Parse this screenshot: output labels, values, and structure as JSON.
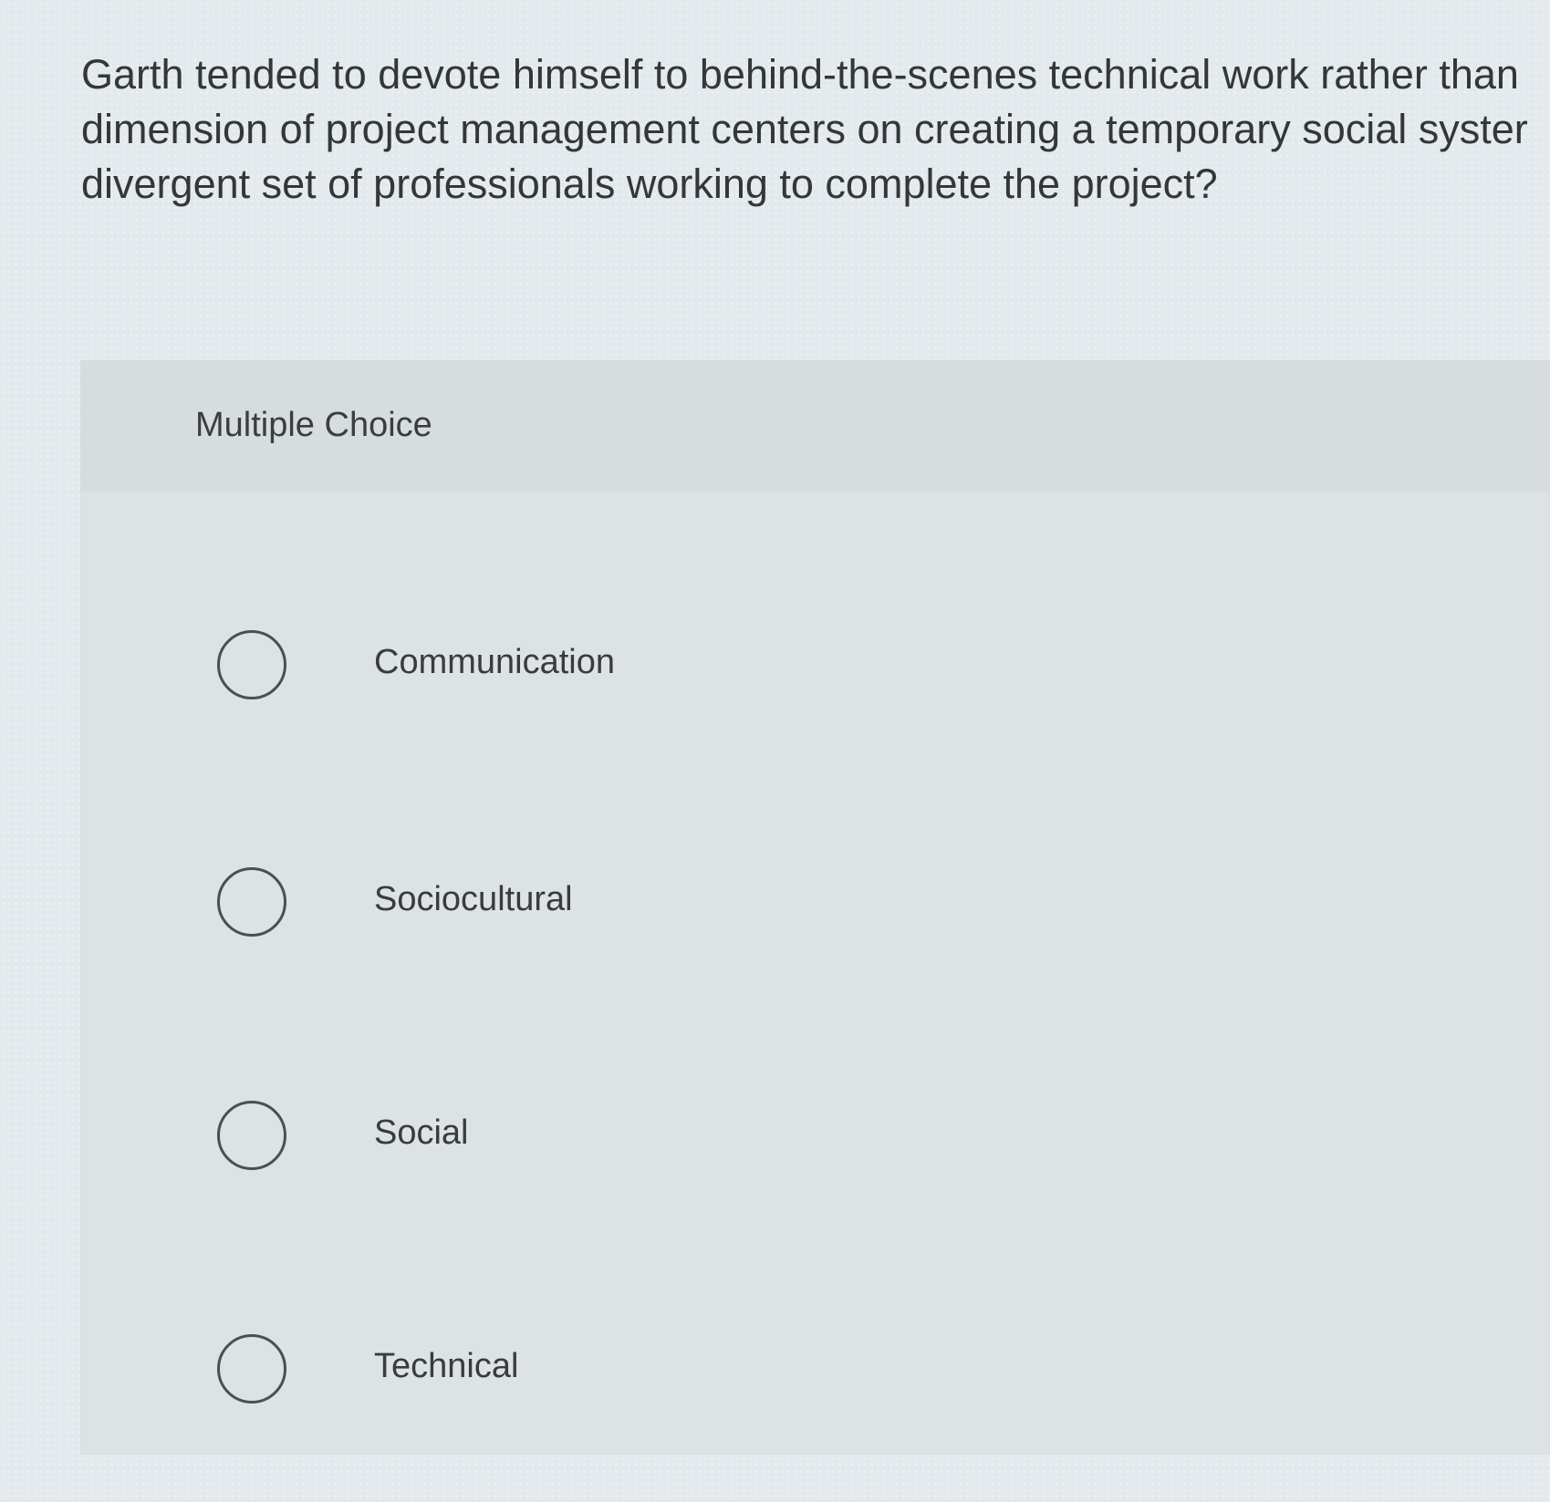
{
  "question": {
    "lines": [
      "Garth tended to devote himself to behind-the-scenes technical work rather than",
      "dimension of project management centers on creating a temporary social syster",
      "divergent set of professionals working to complete the project?"
    ]
  },
  "panel": {
    "label": "Multiple Choice"
  },
  "options": [
    {
      "label": "Communication",
      "selected": false
    },
    {
      "label": "Sociocultural",
      "selected": false
    },
    {
      "label": "Social",
      "selected": false
    },
    {
      "label": "Technical",
      "selected": false
    }
  ]
}
